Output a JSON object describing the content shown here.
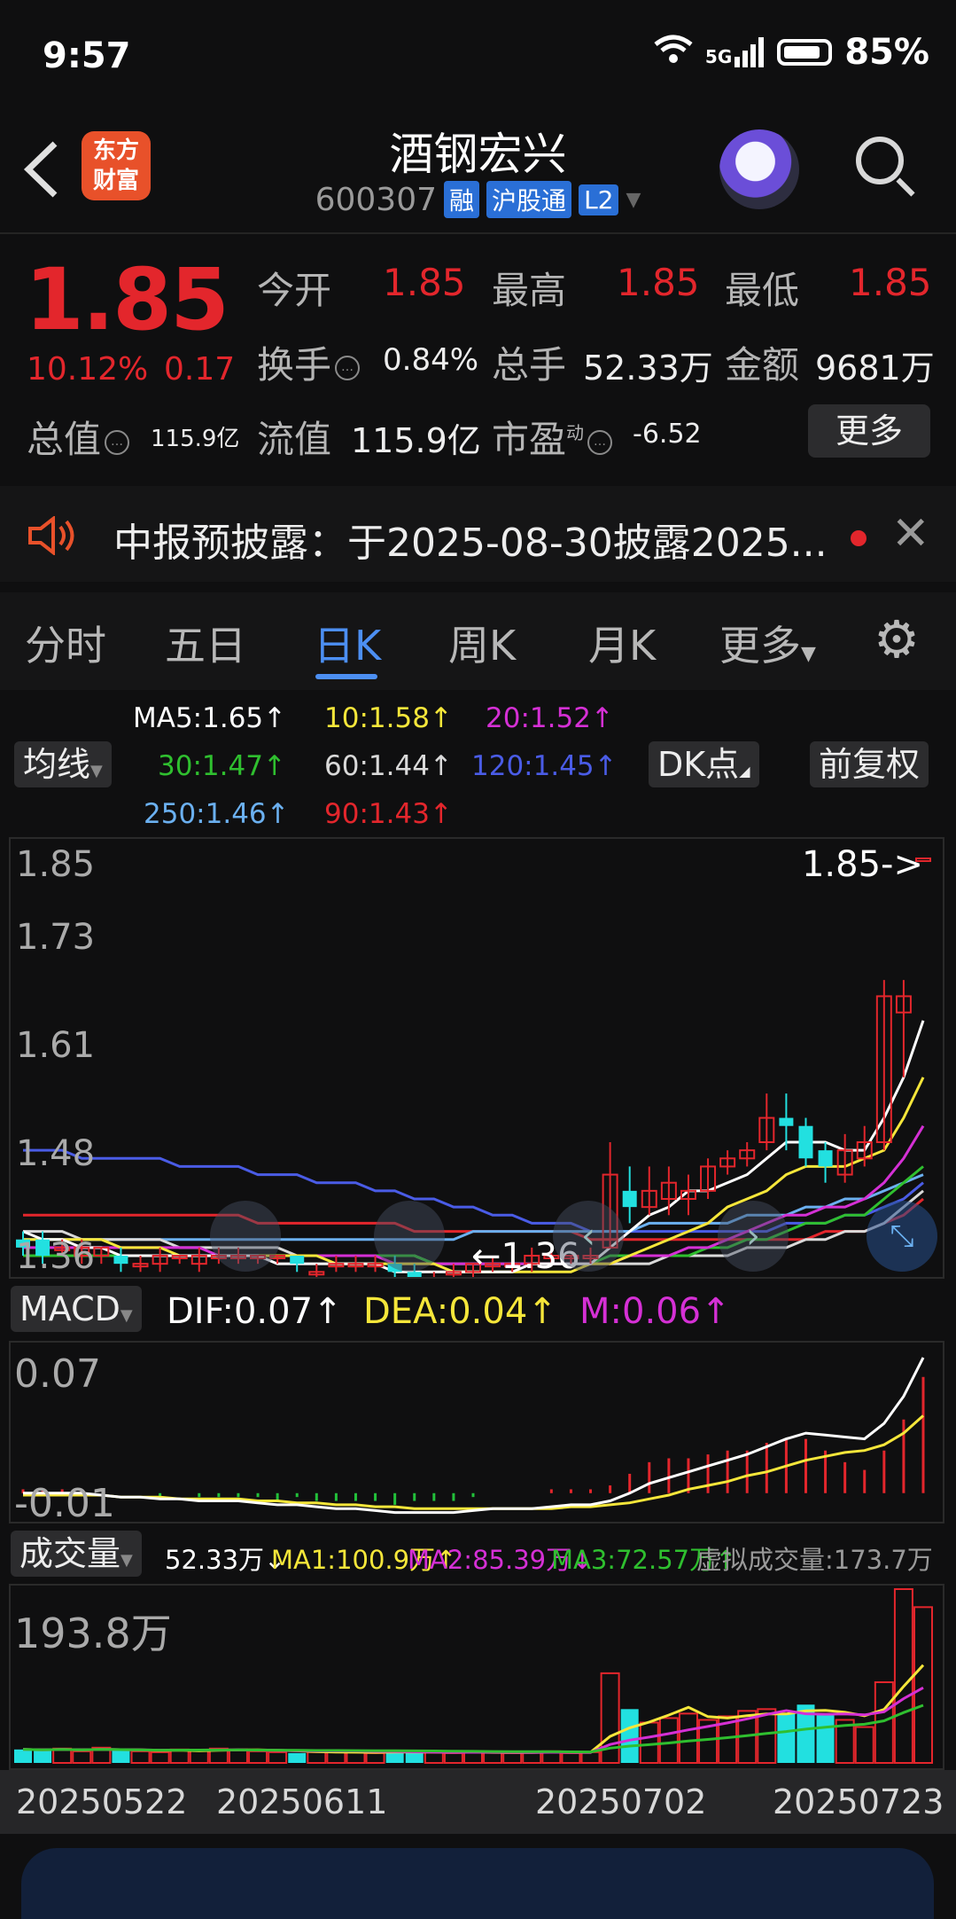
{
  "status_bar": {
    "time": "9:57",
    "network": "5G",
    "battery": "85%"
  },
  "header": {
    "logo_line1": "东方",
    "logo_line2": "财富",
    "title": "酒钢宏兴",
    "code": "600307",
    "tags": [
      "融",
      "沪股通",
      "L2"
    ]
  },
  "quote": {
    "price": "1.85",
    "change_pct": "10.12%",
    "change": "0.17",
    "open_label": "今开",
    "open": "1.85",
    "high_label": "最高",
    "high": "1.85",
    "low_label": "最低",
    "low": "1.85",
    "turnover_label": "换手",
    "turnover": "0.84%",
    "volume_label": "总手",
    "volume": "52.33万",
    "amount_label": "金额",
    "amount": "9681万",
    "mktcap_label": "总值",
    "mktcap": "115.9亿",
    "float_label": "流值",
    "float": "115.9亿",
    "pe_label": "市盈",
    "pe_sup": "动",
    "pe": "-6.52",
    "more": "更多"
  },
  "notice": {
    "text": "中报预披露：于2025-08-30披露2025..."
  },
  "tabs": [
    {
      "label": "分时"
    },
    {
      "label": "五日"
    },
    {
      "label": "日K"
    },
    {
      "label": "周K"
    },
    {
      "label": "月K"
    },
    {
      "label": "更多"
    }
  ],
  "ma_panel": {
    "selector": "均线",
    "dk": "DK点",
    "adjust": "前复权",
    "ma5": "MA5:1.65↑",
    "ma10": "10:1.58↑",
    "ma20": "20:1.52↑",
    "ma30": "30:1.47↑",
    "ma60": "60:1.44↑",
    "ma120": "120:1.45↑",
    "ma250": "250:1.46↑",
    "ma90": "90:1.43↑",
    "colors": {
      "ma5": "#ffffff",
      "ma10": "#f5e63a",
      "ma20": "#d530d5",
      "ma30": "#2fbf2f",
      "ma60": "#d9d9d9",
      "ma120": "#4a5ce6",
      "ma250": "#6bb0f0",
      "ma90": "#e3262c"
    }
  },
  "kline": {
    "y_labels": [
      "1.85",
      "1.73",
      "1.61",
      "1.48",
      "1.36"
    ],
    "last_marker": "1.85->",
    "low_marker": "←1.36"
  },
  "macd": {
    "selector": "MACD",
    "dif": "DIF:0.07↑",
    "dea": "DEA:0.04↑",
    "m": "M:0.06↑",
    "y_top": "0.07",
    "y_bottom": "-0.01"
  },
  "volume": {
    "selector": "成交量",
    "vol": "52.33万↓",
    "ma1": "MA1:100.9万↑",
    "ma2": "MA2:85.39万↓",
    "ma3": "MA3:72.57万↑",
    "virtual": "虚拟成交量:173.7万",
    "y_top": "193.8万"
  },
  "dates": [
    "20250522",
    "20250611",
    "20250702",
    "20250723"
  ],
  "chart_data": {
    "type": "candlestick",
    "candles": [
      {
        "o": 1.38,
        "c": 1.37,
        "h": 1.39,
        "l": 1.36,
        "up": false
      },
      {
        "o": 1.38,
        "c": 1.36,
        "h": 1.39,
        "l": 1.35,
        "up": false
      },
      {
        "o": 1.37,
        "c": 1.37,
        "h": 1.38,
        "l": 1.36,
        "up": true
      },
      {
        "o": 1.36,
        "c": 1.37,
        "h": 1.38,
        "l": 1.35,
        "up": true
      },
      {
        "o": 1.36,
        "c": 1.37,
        "h": 1.37,
        "l": 1.35,
        "up": true
      },
      {
        "o": 1.36,
        "c": 1.35,
        "h": 1.37,
        "l": 1.34,
        "up": false
      },
      {
        "o": 1.35,
        "c": 1.35,
        "h": 1.36,
        "l": 1.34,
        "up": true
      },
      {
        "o": 1.35,
        "c": 1.36,
        "h": 1.37,
        "l": 1.34,
        "up": true
      },
      {
        "o": 1.36,
        "c": 1.36,
        "h": 1.36,
        "l": 1.35,
        "up": true
      },
      {
        "o": 1.36,
        "c": 1.35,
        "h": 1.37,
        "l": 1.34,
        "up": true
      },
      {
        "o": 1.36,
        "c": 1.36,
        "h": 1.37,
        "l": 1.35,
        "up": true
      },
      {
        "o": 1.36,
        "c": 1.36,
        "h": 1.37,
        "l": 1.35,
        "up": true
      },
      {
        "o": 1.36,
        "c": 1.36,
        "h": 1.36,
        "l": 1.35,
        "up": true
      },
      {
        "o": 1.36,
        "c": 1.36,
        "h": 1.36,
        "l": 1.35,
        "up": true
      },
      {
        "o": 1.36,
        "c": 1.35,
        "h": 1.36,
        "l": 1.34,
        "up": false
      },
      {
        "o": 1.34,
        "c": 1.34,
        "h": 1.35,
        "l": 1.33,
        "up": true
      },
      {
        "o": 1.35,
        "c": 1.35,
        "h": 1.36,
        "l": 1.34,
        "up": true
      },
      {
        "o": 1.35,
        "c": 1.35,
        "h": 1.36,
        "l": 1.34,
        "up": true
      },
      {
        "o": 1.35,
        "c": 1.35,
        "h": 1.36,
        "l": 1.34,
        "up": true
      },
      {
        "o": 1.35,
        "c": 1.34,
        "h": 1.36,
        "l": 1.33,
        "up": false
      },
      {
        "o": 1.34,
        "c": 1.33,
        "h": 1.35,
        "l": 1.32,
        "up": false
      },
      {
        "o": 1.33,
        "c": 1.33,
        "h": 1.34,
        "l": 1.33,
        "up": true
      },
      {
        "o": 1.34,
        "c": 1.34,
        "h": 1.35,
        "l": 1.33,
        "up": true
      },
      {
        "o": 1.34,
        "c": 1.35,
        "h": 1.35,
        "l": 1.33,
        "up": true
      },
      {
        "o": 1.35,
        "c": 1.35,
        "h": 1.36,
        "l": 1.34,
        "up": true
      },
      {
        "o": 1.35,
        "c": 1.35,
        "h": 1.36,
        "l": 1.34,
        "up": true
      },
      {
        "o": 1.36,
        "c": 1.35,
        "h": 1.37,
        "l": 1.34,
        "up": true
      },
      {
        "o": 1.36,
        "c": 1.36,
        "h": 1.37,
        "l": 1.35,
        "up": true
      },
      {
        "o": 1.36,
        "c": 1.36,
        "h": 1.36,
        "l": 1.35,
        "up": true
      },
      {
        "o": 1.36,
        "c": 1.36,
        "h": 1.37,
        "l": 1.35,
        "up": true
      },
      {
        "o": 1.37,
        "c": 1.46,
        "h": 1.5,
        "l": 1.37,
        "up": true
      },
      {
        "o": 1.44,
        "c": 1.42,
        "h": 1.47,
        "l": 1.4,
        "up": false
      },
      {
        "o": 1.42,
        "c": 1.44,
        "h": 1.47,
        "l": 1.41,
        "up": true
      },
      {
        "o": 1.43,
        "c": 1.45,
        "h": 1.47,
        "l": 1.41,
        "up": true
      },
      {
        "o": 1.44,
        "c": 1.43,
        "h": 1.46,
        "l": 1.41,
        "up": true
      },
      {
        "o": 1.44,
        "c": 1.47,
        "h": 1.48,
        "l": 1.43,
        "up": true
      },
      {
        "o": 1.47,
        "c": 1.48,
        "h": 1.49,
        "l": 1.46,
        "up": true
      },
      {
        "o": 1.48,
        "c": 1.49,
        "h": 1.5,
        "l": 1.47,
        "up": true
      },
      {
        "o": 1.5,
        "c": 1.53,
        "h": 1.56,
        "l": 1.49,
        "up": true
      },
      {
        "o": 1.53,
        "c": 1.52,
        "h": 1.56,
        "l": 1.49,
        "up": false
      },
      {
        "o": 1.52,
        "c": 1.48,
        "h": 1.53,
        "l": 1.47,
        "up": false
      },
      {
        "o": 1.49,
        "c": 1.47,
        "h": 1.5,
        "l": 1.45,
        "up": false
      },
      {
        "o": 1.46,
        "c": 1.49,
        "h": 1.51,
        "l": 1.45,
        "up": true
      },
      {
        "o": 1.48,
        "c": 1.5,
        "h": 1.52,
        "l": 1.47,
        "up": true
      },
      {
        "o": 1.5,
        "c": 1.68,
        "h": 1.7,
        "l": 1.49,
        "up": true
      },
      {
        "o": 1.66,
        "c": 1.68,
        "h": 1.7,
        "l": 1.58,
        "up": true
      },
      {
        "o": 1.85,
        "c": 1.85,
        "h": 1.85,
        "l": 1.85,
        "up": true
      }
    ],
    "ma5": [
      1.39,
      1.38,
      1.38,
      1.37,
      1.37,
      1.36,
      1.36,
      1.36,
      1.36,
      1.36,
      1.36,
      1.36,
      1.36,
      1.35,
      1.35,
      1.35,
      1.35,
      1.35,
      1.35,
      1.34,
      1.34,
      1.34,
      1.34,
      1.34,
      1.34,
      1.34,
      1.35,
      1.35,
      1.35,
      1.35,
      1.37,
      1.39,
      1.41,
      1.42,
      1.44,
      1.44,
      1.45,
      1.46,
      1.48,
      1.5,
      1.5,
      1.5,
      1.49,
      1.49,
      1.53,
      1.58,
      1.65
    ],
    "ma10": [
      1.38,
      1.38,
      1.38,
      1.38,
      1.38,
      1.37,
      1.37,
      1.37,
      1.36,
      1.36,
      1.36,
      1.36,
      1.36,
      1.36,
      1.36,
      1.36,
      1.35,
      1.35,
      1.35,
      1.35,
      1.35,
      1.35,
      1.34,
      1.34,
      1.34,
      1.34,
      1.34,
      1.34,
      1.34,
      1.35,
      1.35,
      1.36,
      1.37,
      1.38,
      1.39,
      1.4,
      1.42,
      1.43,
      1.44,
      1.46,
      1.47,
      1.47,
      1.47,
      1.48,
      1.49,
      1.53,
      1.58
    ],
    "ma20": [
      1.37,
      1.37,
      1.37,
      1.37,
      1.37,
      1.37,
      1.37,
      1.37,
      1.37,
      1.37,
      1.36,
      1.36,
      1.36,
      1.36,
      1.36,
      1.36,
      1.36,
      1.36,
      1.36,
      1.35,
      1.35,
      1.35,
      1.35,
      1.35,
      1.35,
      1.35,
      1.35,
      1.35,
      1.35,
      1.35,
      1.35,
      1.36,
      1.36,
      1.36,
      1.37,
      1.37,
      1.38,
      1.39,
      1.4,
      1.41,
      1.41,
      1.42,
      1.42,
      1.43,
      1.45,
      1.48,
      1.52
    ],
    "ma30": [
      1.36,
      1.36,
      1.36,
      1.36,
      1.36,
      1.36,
      1.36,
      1.36,
      1.36,
      1.36,
      1.36,
      1.36,
      1.36,
      1.36,
      1.36,
      1.36,
      1.36,
      1.36,
      1.36,
      1.36,
      1.36,
      1.35,
      1.35,
      1.35,
      1.35,
      1.35,
      1.35,
      1.35,
      1.35,
      1.35,
      1.36,
      1.36,
      1.36,
      1.36,
      1.36,
      1.37,
      1.37,
      1.38,
      1.38,
      1.39,
      1.4,
      1.4,
      1.41,
      1.41,
      1.43,
      1.45,
      1.47
    ],
    "ma60": [
      1.39,
      1.39,
      1.39,
      1.38,
      1.38,
      1.38,
      1.38,
      1.38,
      1.37,
      1.37,
      1.37,
      1.37,
      1.37,
      1.37,
      1.36,
      1.36,
      1.36,
      1.36,
      1.36,
      1.36,
      1.36,
      1.35,
      1.35,
      1.35,
      1.35,
      1.35,
      1.35,
      1.35,
      1.35,
      1.35,
      1.35,
      1.35,
      1.35,
      1.36,
      1.36,
      1.36,
      1.36,
      1.37,
      1.37,
      1.37,
      1.38,
      1.38,
      1.39,
      1.39,
      1.4,
      1.42,
      1.44
    ],
    "ma90": [
      1.41,
      1.41,
      1.41,
      1.41,
      1.41,
      1.41,
      1.41,
      1.41,
      1.41,
      1.41,
      1.41,
      1.41,
      1.4,
      1.4,
      1.4,
      1.4,
      1.4,
      1.4,
      1.4,
      1.4,
      1.39,
      1.39,
      1.39,
      1.39,
      1.39,
      1.39,
      1.39,
      1.39,
      1.39,
      1.38,
      1.38,
      1.38,
      1.38,
      1.38,
      1.38,
      1.38,
      1.38,
      1.38,
      1.38,
      1.38,
      1.38,
      1.39,
      1.39,
      1.39,
      1.4,
      1.41,
      1.43
    ],
    "ma120": [
      1.49,
      1.49,
      1.49,
      1.48,
      1.48,
      1.48,
      1.48,
      1.48,
      1.47,
      1.47,
      1.47,
      1.47,
      1.46,
      1.46,
      1.46,
      1.45,
      1.45,
      1.45,
      1.44,
      1.44,
      1.43,
      1.43,
      1.42,
      1.42,
      1.41,
      1.41,
      1.4,
      1.4,
      1.4,
      1.39,
      1.39,
      1.39,
      1.39,
      1.39,
      1.39,
      1.39,
      1.39,
      1.39,
      1.39,
      1.4,
      1.4,
      1.4,
      1.41,
      1.41,
      1.42,
      1.43,
      1.45
    ],
    "ma250": [
      1.38,
      1.38,
      1.38,
      1.38,
      1.38,
      1.38,
      1.38,
      1.38,
      1.38,
      1.38,
      1.38,
      1.38,
      1.38,
      1.38,
      1.38,
      1.38,
      1.38,
      1.38,
      1.38,
      1.38,
      1.38,
      1.38,
      1.38,
      1.39,
      1.39,
      1.39,
      1.39,
      1.39,
      1.39,
      1.39,
      1.39,
      1.39,
      1.4,
      1.4,
      1.4,
      1.4,
      1.4,
      1.41,
      1.41,
      1.41,
      1.42,
      1.42,
      1.43,
      1.43,
      1.44,
      1.45,
      1.46
    ],
    "ylim": [
      1.36,
      1.85
    ],
    "macd_dif": [
      0.0,
      0.0,
      0.0,
      0.0,
      -0.001,
      -0.002,
      -0.002,
      -0.003,
      -0.003,
      -0.004,
      -0.004,
      -0.004,
      -0.005,
      -0.006,
      -0.006,
      -0.007,
      -0.008,
      -0.008,
      -0.009,
      -0.01,
      -0.01,
      -0.01,
      -0.01,
      -0.009,
      -0.008,
      -0.008,
      -0.008,
      -0.007,
      -0.006,
      -0.006,
      -0.004,
      0.0,
      0.005,
      0.008,
      0.011,
      0.014,
      0.017,
      0.02,
      0.024,
      0.028,
      0.031,
      0.03,
      0.029,
      0.028,
      0.036,
      0.05,
      0.07
    ],
    "macd_dea": [
      -0.001,
      -0.001,
      -0.001,
      -0.001,
      -0.001,
      -0.002,
      -0.002,
      -0.002,
      -0.003,
      -0.003,
      -0.003,
      -0.003,
      -0.004,
      -0.004,
      -0.005,
      -0.005,
      -0.006,
      -0.006,
      -0.007,
      -0.007,
      -0.008,
      -0.008,
      -0.008,
      -0.008,
      -0.008,
      -0.008,
      -0.008,
      -0.008,
      -0.007,
      -0.007,
      -0.006,
      -0.005,
      -0.003,
      -0.001,
      0.002,
      0.004,
      0.006,
      0.009,
      0.011,
      0.014,
      0.017,
      0.019,
      0.021,
      0.022,
      0.025,
      0.031,
      0.04
    ],
    "macd_ylim": [
      -0.012,
      0.075
    ],
    "volume_wan": [
      15,
      14,
      16,
      13,
      17,
      14,
      13,
      12,
      15,
      14,
      16,
      15,
      13,
      12,
      11,
      12,
      13,
      12,
      11,
      13,
      12,
      12,
      11,
      12,
      12,
      11,
      12,
      13,
      11,
      12,
      100,
      60,
      45,
      50,
      55,
      48,
      52,
      58,
      60,
      55,
      65,
      55,
      48,
      40,
      90,
      193.8,
      173.7
    ],
    "vol_ylim": [
      0,
      193.8
    ]
  }
}
